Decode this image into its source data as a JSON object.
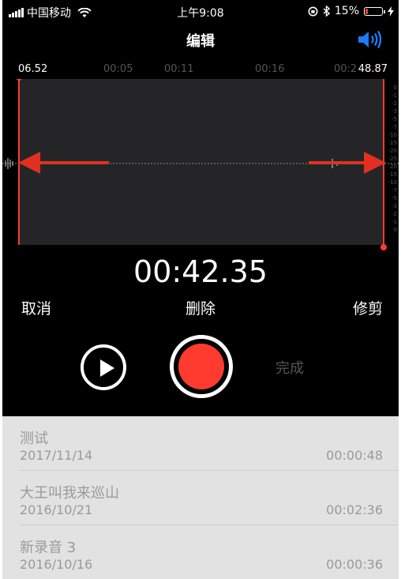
{
  "status_bar": {
    "carrier": "中国移动",
    "time": "上午9:08",
    "battery_percent": "15%",
    "battery_level": 0.15
  },
  "nav": {
    "title": "编辑",
    "speaker_icon": "speaker-volume-icon",
    "accent_color": "#1e7bf5"
  },
  "timeline": {
    "start_time": "06.52",
    "end_time": "48.87",
    "ticks": [
      "00:05",
      "00:11",
      "00:16",
      "00:2"
    ]
  },
  "db_scale": [
    "0",
    "-1",
    "-2",
    "-3",
    "-5",
    "-7",
    "-10",
    "-15",
    "-20",
    "-25",
    "-20",
    "-15",
    "-10",
    "-7",
    "-5",
    "-3",
    "-2",
    "-1",
    "0"
  ],
  "elapsed": "00:42.35",
  "actions": {
    "cancel": "取消",
    "delete": "删除",
    "trim": "修剪"
  },
  "controls": {
    "done": "完成",
    "record_color": "#ff3b30"
  },
  "recordings": [
    {
      "name": "测试",
      "date": "2017/11/14",
      "duration": "00:00:48"
    },
    {
      "name": "大王叫我来巡山",
      "date": "2016/10/21",
      "duration": "00:02:36"
    },
    {
      "name": "新录音 3",
      "date": "2016/10/16",
      "duration": "00:00:36"
    }
  ]
}
